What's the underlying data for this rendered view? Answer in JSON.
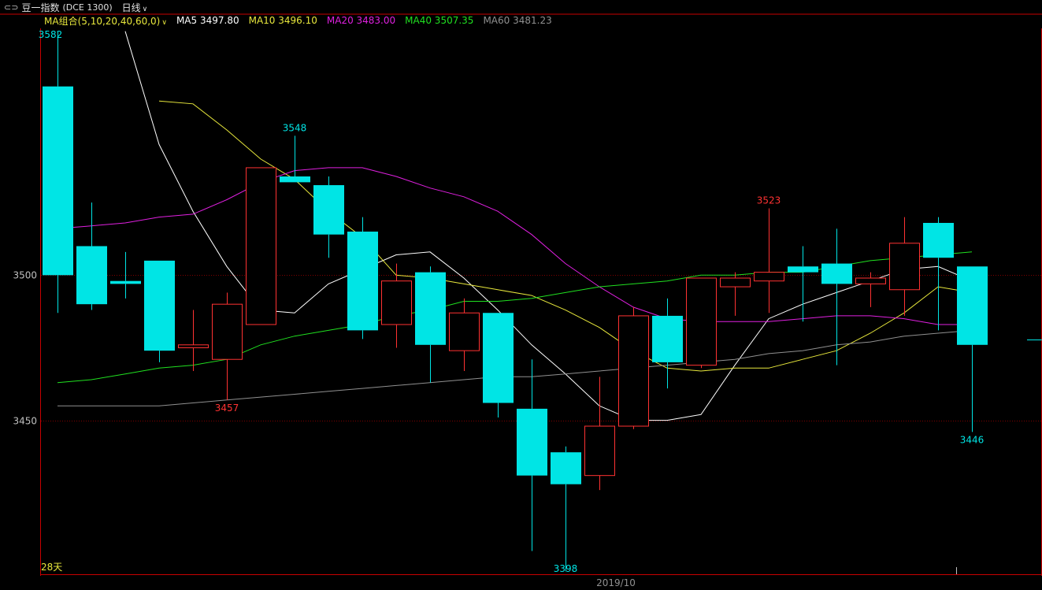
{
  "header": {
    "link_icon": "⊂⊃",
    "symbol_name": "豆一指数",
    "symbol_code": "(DCE 1300)",
    "period": "日线",
    "period_chevron": "chevron-down-icon"
  },
  "ma_bar": {
    "combo_label": "MA组合(5,10,20,40,60,0)",
    "combo_chevron": "chevron-down-icon",
    "items": [
      {
        "label": "MA5 3497.80",
        "color": "#ffffff"
      },
      {
        "label": "MA10 3496.10",
        "color": "#e8e83c"
      },
      {
        "label": "MA20 3483.00",
        "color": "#e020e0"
      },
      {
        "label": "MA40 3507.35",
        "color": "#20e020"
      },
      {
        "label": "MA60 3481.23",
        "color": "#909090"
      }
    ]
  },
  "colors": {
    "up": "#ff3232",
    "down": "#00e5e5",
    "frame": "#c80000",
    "grid": "#800000"
  },
  "chart_data": {
    "type": "candlestick",
    "x_label": "2019/10",
    "corner_label": "28天",
    "y_ticks": [
      3450,
      3500
    ],
    "ylim": [
      3397,
      3585
    ],
    "candles": [
      {
        "o": 3565,
        "h": 3584,
        "l": 3487,
        "c": 3500
      },
      {
        "o": 3510,
        "h": 3525,
        "l": 3488,
        "c": 3490
      },
      {
        "o": 3498,
        "h": 3508,
        "l": 3492,
        "c": 3497
      },
      {
        "o": 3505,
        "h": 3505,
        "l": 3470,
        "c": 3474
      },
      {
        "o": 3475,
        "h": 3488,
        "l": 3467,
        "c": 3476
      },
      {
        "o": 3471,
        "h": 3494,
        "l": 3457,
        "c": 3490
      },
      {
        "o": 3483,
        "h": 3531,
        "l": 3483,
        "c": 3537
      },
      {
        "o": 3534,
        "h": 3548,
        "l": 3532,
        "c": 3532
      },
      {
        "o": 3531,
        "h": 3534,
        "l": 3506,
        "c": 3514
      },
      {
        "o": 3515,
        "h": 3520,
        "l": 3478,
        "c": 3481
      },
      {
        "o": 3483,
        "h": 3504,
        "l": 3475,
        "c": 3498
      },
      {
        "o": 3501,
        "h": 3503,
        "l": 3463,
        "c": 3476
      },
      {
        "o": 3474,
        "h": 3492,
        "l": 3467,
        "c": 3487
      },
      {
        "o": 3487,
        "h": 3487,
        "l": 3451,
        "c": 3456
      },
      {
        "o": 3454,
        "h": 3471,
        "l": 3405,
        "c": 3431
      },
      {
        "o": 3439,
        "h": 3441,
        "l": 3398,
        "c": 3428
      },
      {
        "o": 3431,
        "h": 3465,
        "l": 3426,
        "c": 3448
      },
      {
        "o": 3448,
        "h": 3489,
        "l": 3447,
        "c": 3486
      },
      {
        "o": 3486,
        "h": 3492,
        "l": 3461,
        "c": 3470
      },
      {
        "o": 3469,
        "h": 3498,
        "l": 3468,
        "c": 3499
      },
      {
        "o": 3496,
        "h": 3501,
        "l": 3486,
        "c": 3499
      },
      {
        "o": 3498,
        "h": 3523,
        "l": 3487,
        "c": 3501
      },
      {
        "o": 3503,
        "h": 3510,
        "l": 3484,
        "c": 3501
      },
      {
        "o": 3504,
        "h": 3516,
        "l": 3469,
        "c": 3497
      },
      {
        "o": 3497,
        "h": 3501,
        "l": 3489,
        "c": 3499
      },
      {
        "o": 3495,
        "h": 3520,
        "l": 3486,
        "c": 3511
      },
      {
        "o": 3518,
        "h": 3520,
        "l": 3481,
        "c": 3506
      },
      {
        "o": 3503,
        "h": 3503,
        "l": 3446,
        "c": 3476
      }
    ],
    "annotations": [
      {
        "i": 0,
        "text": "3582",
        "side": "high"
      },
      {
        "i": 7,
        "text": "3548",
        "side": "high"
      },
      {
        "i": 5,
        "text": "3457",
        "side": "low"
      },
      {
        "i": 15,
        "text": "3398",
        "side": "low"
      },
      {
        "i": 21,
        "text": "3523",
        "side": "high"
      },
      {
        "i": 27,
        "text": "3446",
        "side": "low"
      }
    ],
    "series": [
      {
        "name": "MA5",
        "color": "#ffffff",
        "values": [
          3584,
          3545,
          3522,
          3503,
          3488,
          3487,
          3497,
          3502,
          3507,
          3508,
          3499,
          3488,
          3476,
          3466,
          3455,
          3450,
          3450,
          3452,
          3469,
          3485,
          3490,
          3494,
          3498,
          3502,
          3503,
          3498
        ]
      },
      {
        "name": "MA10",
        "color": "#e8e83c",
        "values": [
          3560,
          3559,
          3550,
          3540,
          3533,
          3522,
          3513,
          3500,
          3499,
          3497,
          3495,
          3493,
          3488,
          3482,
          3474,
          3468,
          3467,
          3468,
          3468,
          3471,
          3474,
          3480,
          3487,
          3496,
          3494
        ]
      },
      {
        "name": "MA20",
        "color": "#e020e0",
        "values": [
          3516,
          3517,
          3518,
          3520,
          3521,
          3526,
          3532,
          3536,
          3537,
          3537,
          3534,
          3530,
          3527,
          3522,
          3514,
          3504,
          3496,
          3489,
          3485,
          3484,
          3484,
          3484,
          3485,
          3486,
          3486,
          3485,
          3483,
          3483
        ]
      },
      {
        "name": "MA40",
        "color": "#20e020",
        "values": [
          3463,
          3464,
          3466,
          3468,
          3469,
          3471,
          3476,
          3479,
          3481,
          3483,
          3486,
          3488,
          3491,
          3491,
          3492,
          3494,
          3496,
          3497,
          3498,
          3500,
          3500,
          3501,
          3501,
          3503,
          3505,
          3506,
          3507,
          3508
        ]
      },
      {
        "name": "MA60",
        "color": "#909090",
        "values": [
          3455,
          3455,
          3455,
          3455,
          3456,
          3457,
          3458,
          3459,
          3460,
          3461,
          3462,
          3463,
          3464,
          3465,
          3465,
          3466,
          3467,
          3468,
          3469,
          3470,
          3471,
          3473,
          3474,
          3476,
          3477,
          3479,
          3480,
          3481
        ]
      }
    ]
  }
}
